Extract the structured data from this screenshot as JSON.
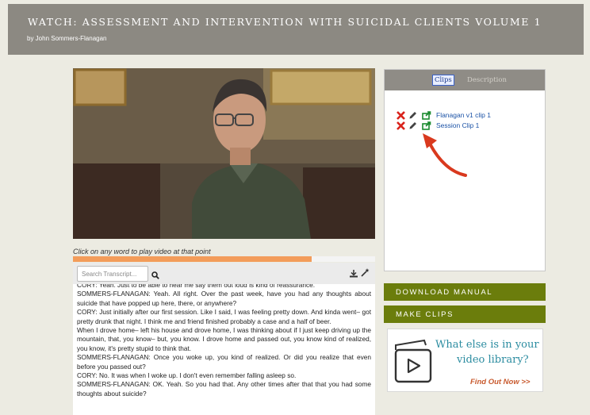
{
  "header": {
    "title": "WATCH: ASSESSMENT AND INTERVENTION WITH SUICIDAL CLIENTS VOLUME 1",
    "author": "by John Sommers-Flanagan"
  },
  "player": {
    "hint": "Click on any word to play video at that point",
    "progress": 0.79
  },
  "transcript": {
    "search_placeholder": "Search Transcript...",
    "lines": [
      "CORY: Yeah. Just to be able to hear me say them out loud is kind of reassurance.",
      "SOMMERS-FLANAGAN: Yeah. All right. Over the past week, have you had any thoughts about suicide that have popped up here, there, or anywhere?",
      "CORY: Just initially after our first session. Like I said, I was feeling pretty down. And kinda went– got pretty drunk that night. I think me and friend finished probably a case and a half of beer.",
      "When I drove home– left his house and drove home, I was thinking about if I just keep driving up the mountain, that, you know– but, you know. I drove home and passed out, you know kind of realized, you know, it's pretty stupid to think that.",
      "SOMMERS-FLANAGAN: Once you woke up, you kind of realized. Or did you realize that even before you passed out?",
      "CORY: No. It was when I woke up. I don't even remember falling asleep so.",
      "SOMMERS-FLANAGAN: OK. Yeah. So you had that. Any other times after that that you had some thoughts about suicide?"
    ]
  },
  "side_panel": {
    "tabs": [
      "Clips",
      "Description"
    ],
    "active_tab": "Clips",
    "clips": [
      {
        "label": "Flanagan v1 clip 1"
      },
      {
        "label": "Session Clip 1"
      }
    ]
  },
  "buttons": {
    "download_manual": "DOWNLOAD MANUAL",
    "make_clips": "MAKE CLIPS"
  },
  "promo": {
    "line1": "What else is in your",
    "line2": "video library?",
    "link": "Find Out Now >>"
  },
  "colors": {
    "header_bg": "#8c8982",
    "accent_green": "#6b7d0c",
    "progress_orange": "#f39c5a",
    "link_blue": "#1b52a6",
    "promo_teal": "#2b8ca0",
    "arrow_red": "#d9391e"
  },
  "icons": [
    "search-icon",
    "download-icon",
    "magic-wand-icon",
    "delete-icon",
    "pencil-icon",
    "share-icon",
    "video-play-icon"
  ]
}
